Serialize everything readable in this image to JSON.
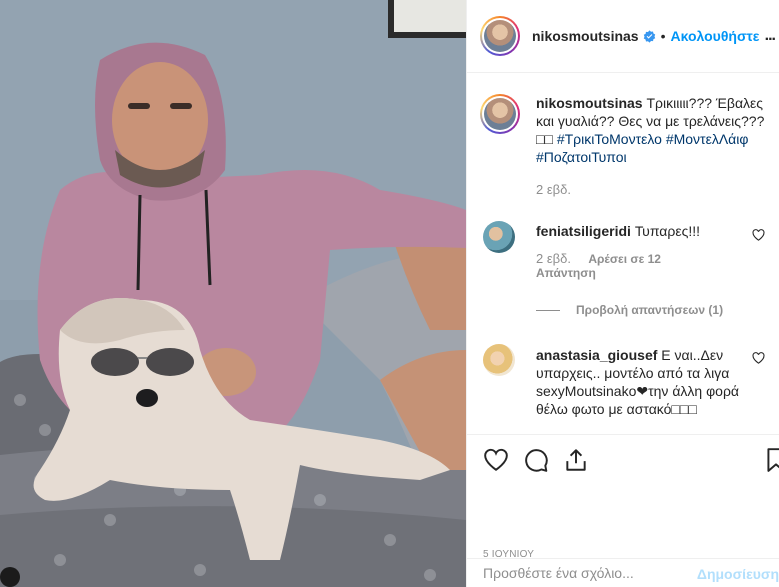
{
  "post": {
    "username": "nikosmoutsinas",
    "follow_label": "Ακολουθήστε",
    "dot": "•",
    "more_label": "...",
    "caption": {
      "username": "nikosmoutsinas",
      "text": "Τρικιιιιι??? Έβαλες και γυαλιά?? Θες να με τρελάνεις???",
      "emoji_boxes": "□□",
      "hashtags": "#ΤρικιΤοΜοντελο #ΜοντελΛάιφ #ΠοζατοιΤυποι",
      "time": "2 εβδ."
    },
    "comments": [
      {
        "username": "feniatsiligeridi",
        "text": "Τυπαρες!!!",
        "time": "2 εβδ.",
        "likes": "Αρέσει σε 12",
        "reply": "Απάντηση",
        "view_replies": "Προβολή απαντήσεων (1)"
      },
      {
        "username": "anastasia_giousef",
        "text": "Ε ναι..Δεν υπαρχεις.. μοντέλο από τα λιγα sexyMoutsinako❤την άλλη φορά θέλω φωτο με αστακό□□□"
      }
    ],
    "likes_line": "",
    "date": "5 ΙΟΥΝΙΟΥ",
    "add_comment_placeholder": "Προσθέστε ένα σχόλιο...",
    "post_label": "Δημοσίευση"
  },
  "icons": {
    "verified": "verified-badge-icon",
    "like": "heart-icon",
    "comment": "comment-icon",
    "share": "share-icon",
    "save": "bookmark-icon"
  },
  "colors": {
    "link": "#0095f6",
    "hashtag": "#00376b",
    "muted": "#8e8e8e",
    "hoodie": "#b9879f"
  }
}
